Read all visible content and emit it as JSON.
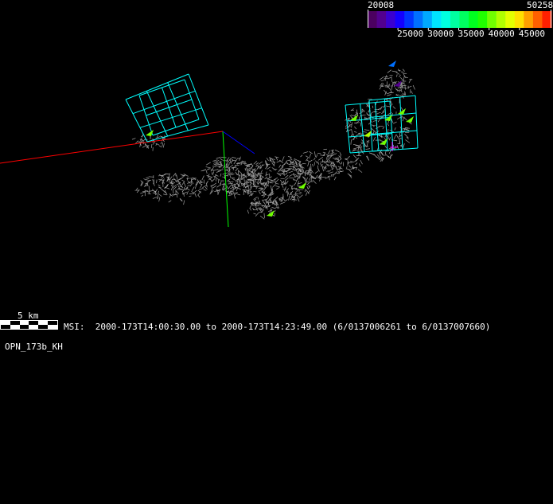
{
  "colorbar": {
    "min_label": "20008",
    "max_label": "50258",
    "min": 20008,
    "max": 50258,
    "ticks": [
      "25000",
      "30000",
      "35000",
      "40000",
      "45000"
    ],
    "colors": [
      "#4b0060",
      "#52008f",
      "#3a00d0",
      "#1400ff",
      "#0034ff",
      "#0070ff",
      "#00a8ff",
      "#00e4ff",
      "#00ffe0",
      "#00ffa0",
      "#00ff60",
      "#00ff20",
      "#20ff00",
      "#70ff00",
      "#b0ff00",
      "#e4ff00",
      "#ffe000",
      "#ffa000",
      "#ff6000",
      "#ff2000"
    ]
  },
  "scale_bar": {
    "label": "5 km"
  },
  "info": {
    "msi_text": "MSI:  2000-173T14:00:30.00 to 2000-173T14:23:49.00 (6/0137006261 to 6/0137007660)",
    "dataset": "OPN_173b_KH"
  },
  "scene": {
    "axis_colors": {
      "x": "#ff0000",
      "y": "#00ff00",
      "z": "#0000ff"
    },
    "footprint_color": "#00ffff",
    "mesh_color": "#a0a0a0"
  }
}
